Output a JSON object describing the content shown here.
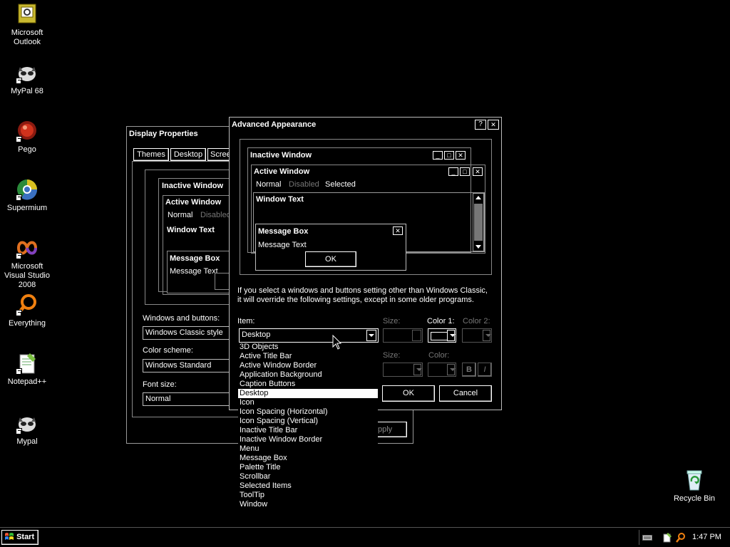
{
  "desktop_icons": [
    {
      "label": "Microsoft Outlook",
      "icon": "outlook-icon"
    },
    {
      "label": "MyPal 68",
      "icon": "raccoon-icon"
    },
    {
      "label": "Pego",
      "icon": "pego-icon"
    },
    {
      "label": "Supermium",
      "icon": "supermium-icon"
    },
    {
      "label": "Microsoft Visual Studio 2008",
      "icon": "visual-studio-icon"
    },
    {
      "label": "Everything",
      "icon": "search-magnifier-icon"
    },
    {
      "label": "Notepad++",
      "icon": "notepadpp-icon"
    },
    {
      "label": "Mypal",
      "icon": "raccoon-icon"
    },
    {
      "label": "Recycle Bin",
      "icon": "recycle-bin-icon"
    }
  ],
  "display_properties": {
    "title": "Display Properties",
    "tabs": [
      "Themes",
      "Desktop",
      "Scree"
    ],
    "preview": {
      "inactive": "Inactive Window",
      "active": "Active Window",
      "normal": "Normal",
      "disabled": "Disabled",
      "window_text": "Window Text",
      "message_box": "Message Box",
      "message_text": "Message Text"
    },
    "windows_buttons_label": "Windows and buttons:",
    "windows_buttons_value": "Windows Classic style",
    "color_scheme_label": "Color scheme:",
    "color_scheme_value": "Windows Standard",
    "font_size_label": "Font size:",
    "font_size_value": "Normal",
    "apply_label": "pply"
  },
  "advanced": {
    "title": "Advanced Appearance",
    "help": "?",
    "close": "✕",
    "preview": {
      "inactive": "Inactive Window",
      "active": "Active Window",
      "normal": "Normal",
      "disabled": "Disabled",
      "selected": "Selected",
      "window_text": "Window Text",
      "message_box": "Message Box",
      "message_text": "Message Text",
      "ok": "OK"
    },
    "info_line1": "If you select a windows and buttons setting other than Windows Classic,",
    "info_line2": "it will override the following settings, except in some older programs.",
    "item_label": "Item:",
    "item_value": "Desktop",
    "size_label": "Size:",
    "color1_label": "Color 1:",
    "color2_label": "Color 2:",
    "size2_label": "Size:",
    "color_label": "Color:",
    "bold": "B",
    "italic": "I",
    "ok": "OK",
    "cancel": "Cancel",
    "items": [
      "3D Objects",
      "Active Title Bar",
      "Active Window Border",
      "Application Background",
      "Caption Buttons",
      "Desktop",
      "Icon",
      "Icon Spacing (Horizontal)",
      "Icon Spacing (Vertical)",
      "Inactive Title Bar",
      "Inactive Window Border",
      "Menu",
      "Message Box",
      "Palette Title",
      "Scrollbar",
      "Selected Items",
      "ToolTip",
      "Window"
    ],
    "selected_index": 5
  },
  "taskbar": {
    "start": "Start",
    "clock": "1:47 PM"
  }
}
